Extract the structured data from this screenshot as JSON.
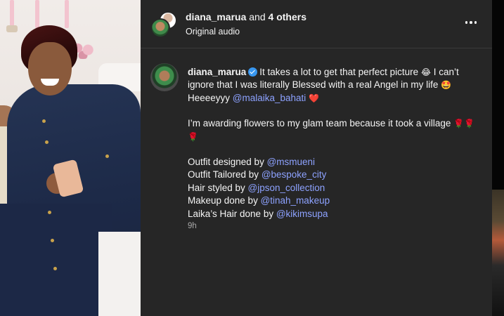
{
  "header": {
    "username": "diana_marua",
    "and_others": " and ",
    "others_count": "4 others",
    "audio": "Original audio"
  },
  "comment": {
    "username": "diana_marua",
    "line1_a": "It takes a lot to get that perfect picture ",
    "emoji_laugh": "😂",
    "line1_b": " I can’t ignore that I was literally Blessed with a real Angel in my life ",
    "emoji_star": "🤩",
    "line2_a": "Heeeeyyy ",
    "mention_malaika": "@malaika_bahati",
    "emoji_heart": "❤️",
    "line3": "I’m awarding flowers to my glam team because it took a village ",
    "emoji_roses": "🌹🌹🌹",
    "credits": [
      {
        "label": "Outfit designed by ",
        "mention": "@msmueni"
      },
      {
        "label": "Outfit Tailored by ",
        "mention": "@bespoke_city"
      },
      {
        "label": "Hair styled by ",
        "mention": "@jpson_collection"
      },
      {
        "label": "Makeup done by ",
        "mention": "@tinah_makeup"
      },
      {
        "label": "Laika’s Hair done by ",
        "mention": "@kikimsupa"
      }
    ],
    "time": "9h"
  },
  "colors": {
    "panel_bg": "#262626",
    "mention": "#8da2ff",
    "verified": "#3897f0"
  },
  "icons": {
    "more": "more-horizontal-icon",
    "verified": "verified-badge-icon"
  }
}
